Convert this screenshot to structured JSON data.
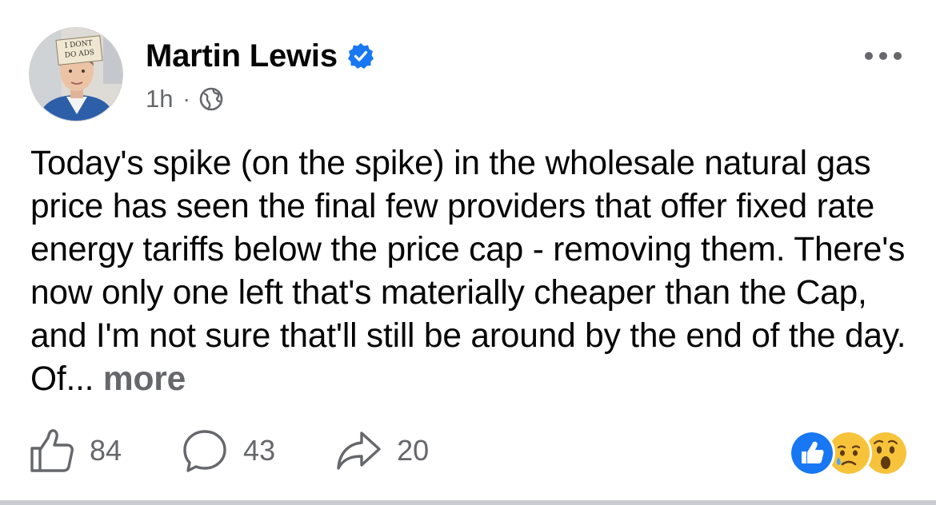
{
  "post": {
    "author": "Martin Lewis",
    "verified": true,
    "timestamp": "1h",
    "separator": "·",
    "audience_icon": "globe-icon",
    "avatar_badge_text": "I DONT DO ADS",
    "body": "Today's spike (on the spike) in the wholesale natural gas price has seen the final few providers that offer fixed rate energy tariffs below the price cap - removing them. There's now only one left that's materially cheaper than the Cap, and I'm not sure that'll still be around by the end of the day. Of...",
    "see_more_label": "more"
  },
  "actions": {
    "like_count": "84",
    "comment_count": "43",
    "share_count": "20"
  },
  "reactions": [
    "like",
    "sad",
    "wow"
  ],
  "colors": {
    "brand_blue": "#1877f2",
    "secondary_text": "#65676b",
    "primary_text": "#050505"
  }
}
